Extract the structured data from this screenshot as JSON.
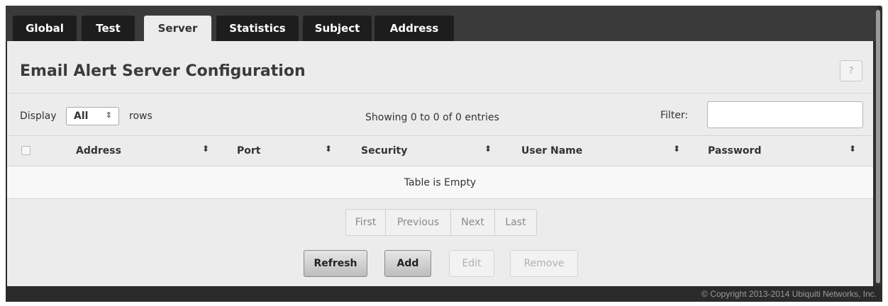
{
  "tabs": [
    {
      "label": "Global",
      "active": false
    },
    {
      "label": "Test",
      "active": false
    },
    {
      "label": "Server",
      "active": true
    },
    {
      "label": "Statistics",
      "active": false
    },
    {
      "label": "Subject",
      "active": false
    },
    {
      "label": "Address",
      "active": false
    }
  ],
  "page": {
    "title": "Email Alert Server Configuration",
    "help_label": "?"
  },
  "controls": {
    "display_label": "Display",
    "display_value": "All",
    "display_arrows": "⇕",
    "rows_label": "rows",
    "showing_text": "Showing 0 to 0 of 0 entries",
    "filter_label": "Filter:",
    "filter_value": ""
  },
  "table": {
    "columns": [
      "Address",
      "Port",
      "Security",
      "User Name",
      "Password"
    ],
    "sort_glyph": "⬍",
    "empty_text": "Table is Empty",
    "rows": []
  },
  "pagination": {
    "first": "First",
    "previous": "Previous",
    "next": "Next",
    "last": "Last"
  },
  "actions": {
    "refresh": "Refresh",
    "add": "Add",
    "edit": "Edit",
    "remove": "Remove"
  },
  "footer": {
    "copyright": "© Copyright 2013-2014 Ubiquiti Networks, Inc."
  },
  "colors": {
    "tab_bg": "#1d1d1d",
    "tab_active_bg": "#ececec",
    "panel_bg": "#ececec",
    "frame_bg": "#2e2e2e"
  }
}
